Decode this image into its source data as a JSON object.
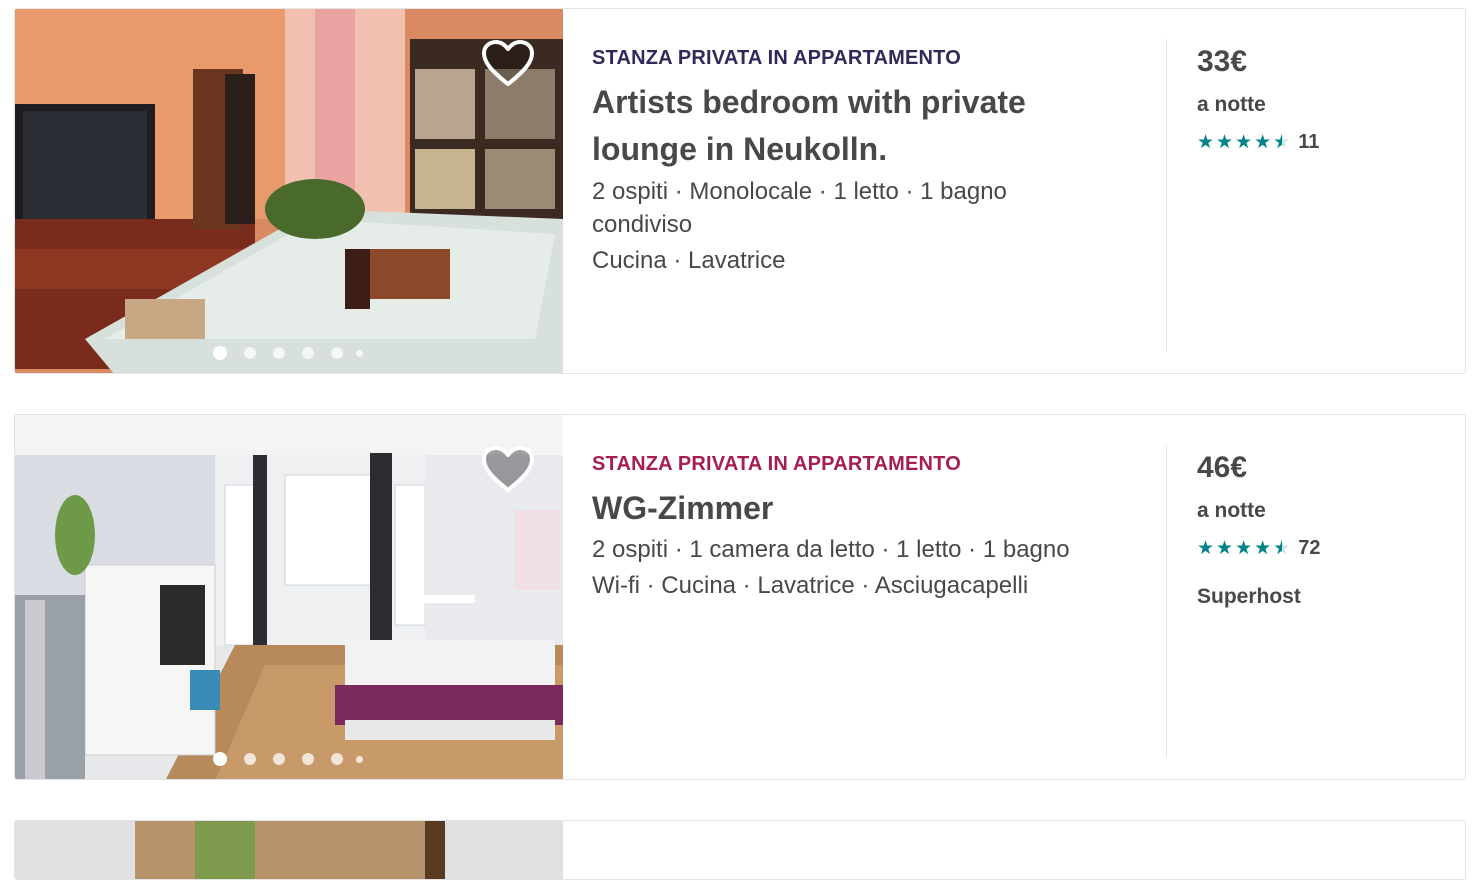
{
  "listings": [
    {
      "type": "STANZA PRIVATA IN APPARTAMENTO",
      "type_color": "#32285a",
      "title_line1": "Artists bedroom with private",
      "title_line2": "lounge in Neukolln.",
      "specs_line1": "2 ospiti · Monolocale · 1 letto · 1 bagno",
      "specs_line2": "condiviso",
      "amenities": "Cucina · Lavatrice",
      "price": "33€",
      "per_night": "a notte",
      "rating_stars": 4.5,
      "reviews": "11",
      "superhost": ""
    },
    {
      "type": "STANZA PRIVATA IN APPARTAMENTO",
      "type_color": "#a61d55",
      "title_line1": "WG-Zimmer",
      "title_line2": "",
      "specs_line1": "2 ospiti · 1 camera da letto · 1 letto · 1 bagno",
      "specs_line2": "",
      "amenities": "Wi-fi · Cucina · Lavatrice · Asciugacapelli",
      "price": "46€",
      "per_night": "a notte",
      "rating_stars": 4.5,
      "reviews": "72",
      "superhost": "Superhost"
    }
  ],
  "colors": {
    "star": "#008489",
    "text": "#484848",
    "border": "#e4e4e4"
  },
  "icons": {
    "favorite": "heart-outline-icon",
    "carousel": "carousel-dots"
  },
  "carousel": {
    "active_index": 0,
    "dot_count": 6
  }
}
